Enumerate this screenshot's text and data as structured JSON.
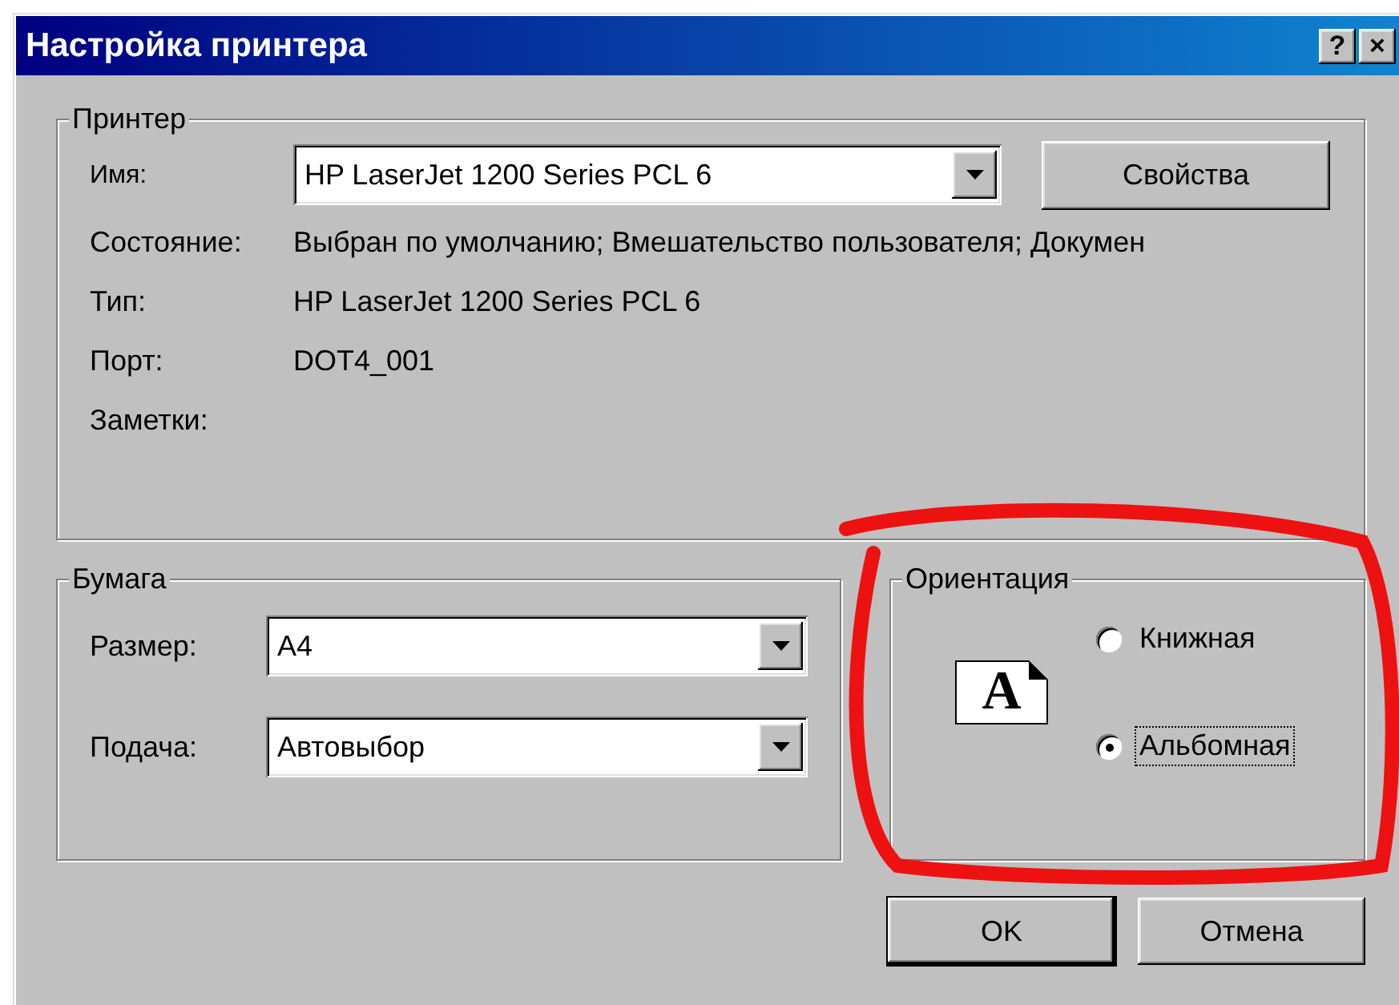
{
  "window": {
    "title": "Настройка принтера",
    "help_button": "?",
    "close_button": "×"
  },
  "printer": {
    "legend": "Принтер",
    "name": {
      "label": "Имя:",
      "value": "HP LaserJet 1200 Series PCL 6"
    },
    "properties_button": "Свойства",
    "info": [
      {
        "label": "Состояние:",
        "value": "Выбран по умолчанию; Вмешательство пользователя; Докумен"
      },
      {
        "label": "Тип:",
        "value": "HP LaserJet 1200 Series PCL 6"
      },
      {
        "label": "Порт:",
        "value": "DOT4_001"
      },
      {
        "label": "Заметки:"
      }
    ]
  },
  "paper": {
    "legend": "Бумага",
    "fields": [
      {
        "label": "Размер:",
        "value": "A4"
      },
      {
        "label": "Подача:",
        "value": "Автовыбор"
      }
    ]
  },
  "orientation": {
    "legend": "Ориентация",
    "preview_letter": "A",
    "options": [
      {
        "label": "Книжная",
        "selected": false,
        "focused": false
      },
      {
        "label": "Альбомная",
        "selected": true,
        "focused": true
      }
    ]
  },
  "buttons": [
    {
      "label": "OK",
      "default": true
    },
    {
      "label": "Отмена",
      "default": false
    }
  ]
}
